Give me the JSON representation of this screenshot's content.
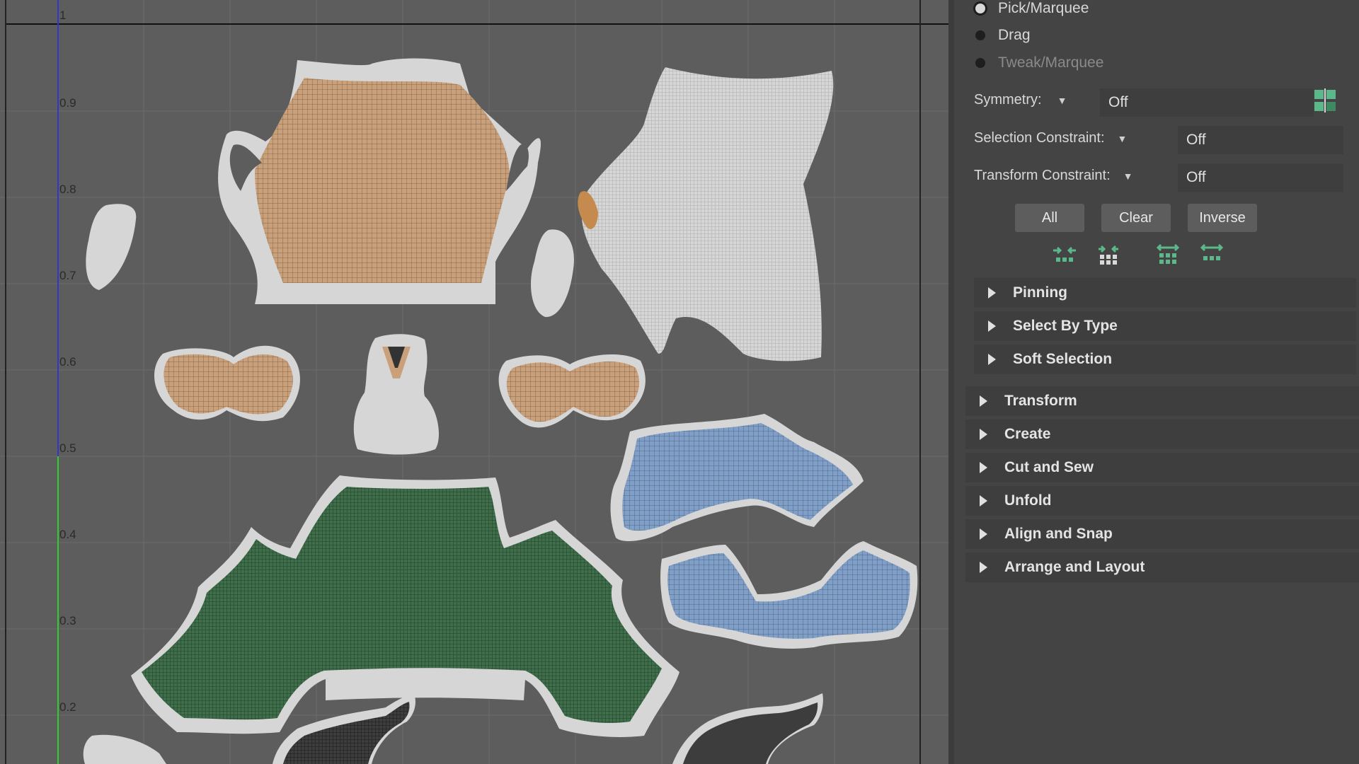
{
  "uv_editor": {
    "ticks": [
      "1",
      "0.9",
      "0.8",
      "0.7",
      "0.6",
      "0.5",
      "0.4",
      "0.3",
      "0.2"
    ]
  },
  "tool_options": {
    "radios": [
      {
        "label": "Pick/Marquee",
        "selected": true,
        "enabled": true
      },
      {
        "label": "Drag",
        "selected": false,
        "enabled": true
      },
      {
        "label": "Tweak/Marquee",
        "selected": false,
        "enabled": false
      }
    ],
    "symmetry": {
      "label": "Symmetry:",
      "value": "Off",
      "icon": "symmetry-icon"
    },
    "selection_constraint": {
      "label": "Selection Constraint:",
      "value": "Off"
    },
    "transform_constraint": {
      "label": "Transform Constraint:",
      "value": "Off"
    },
    "buttons": {
      "all": "All",
      "clear": "Clear",
      "inverse": "Inverse"
    },
    "selection_tools": [
      "shrink-selection-icon",
      "grow-selection-icon",
      "select-shell-icon",
      "select-border-icon"
    ],
    "subsections": [
      "Pinning",
      "Select By Type",
      "Soft Selection"
    ],
    "sections": [
      "Transform",
      "Create",
      "Cut and Sew",
      "Unfold",
      "Align and Snap",
      "Arrange and Layout"
    ]
  },
  "colors": {
    "uv_orange": "#c9a07a",
    "uv_green": "#3f6f4a",
    "uv_blue": "#7f9fc8",
    "accent_green": "#5cb88a"
  }
}
